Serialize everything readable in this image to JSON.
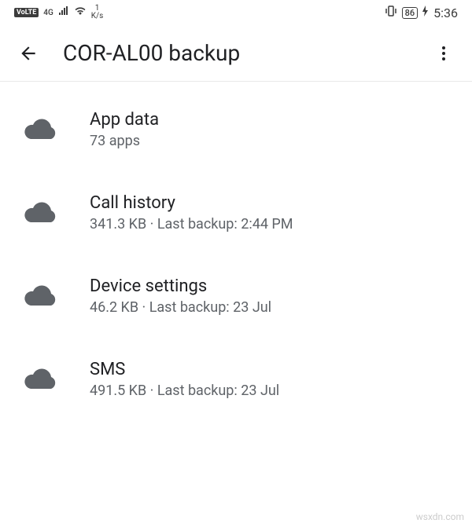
{
  "status": {
    "volte": "VoLTE",
    "network": "4G",
    "speed_value": "1",
    "speed_unit": "K/s",
    "battery": "86",
    "time": "5:36"
  },
  "header": {
    "title": "COR-AL00 backup"
  },
  "items": [
    {
      "title": "App data",
      "subtitle": "73 apps"
    },
    {
      "title": "Call history",
      "subtitle": "341.3 KB · Last backup: 2:44 PM"
    },
    {
      "title": "Device settings",
      "subtitle": "46.2 KB · Last backup: 23 Jul"
    },
    {
      "title": "SMS",
      "subtitle": "491.5 KB · Last backup: 23 Jul"
    }
  ],
  "watermark": "wsxdn.com"
}
